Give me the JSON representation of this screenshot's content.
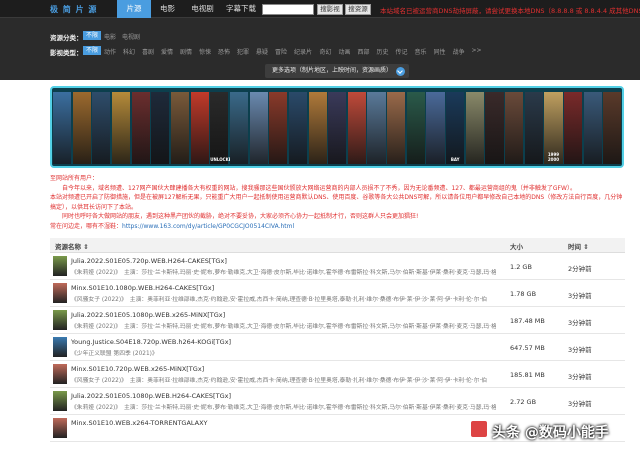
{
  "header": {
    "logo": "极 简 片 源",
    "tabs": [
      {
        "label": "片源",
        "active": true
      },
      {
        "label": "电影",
        "active": false
      },
      {
        "label": "电视剧",
        "active": false
      },
      {
        "label": "字幕下载",
        "active": false
      }
    ],
    "search_value": "",
    "search_btn": "搜影视",
    "search_btn2": "搜资源",
    "notice": "本站域名已被运营商DNS劫持屏蔽，请尝试更换本地DNS（8.8.8.8 或 8.8.4.4 成其他DNS）"
  },
  "filters": {
    "row1_label": "资源分类：",
    "row1_selected": "不限",
    "row1_options": [
      "电影",
      "电视剧"
    ],
    "row2_label": "影视类型：",
    "row2_selected": "不限",
    "row2_options": [
      "动作",
      "科幻",
      "喜剧",
      "爱情",
      "剧情",
      "惊悚",
      "恐怖",
      "犯罪",
      "悬疑",
      "冒险",
      "纪录片",
      "奇幻",
      "动画",
      "西部",
      "历史",
      "传记",
      "音乐",
      "同性",
      "战争",
      ">>"
    ],
    "more_label": "更多选项（制片地区，上映时间，资源画质）"
  },
  "banner": {
    "posters": [
      {
        "title": "",
        "color": "#3b6fa0"
      },
      {
        "title": "",
        "color": "#9c6a2e"
      },
      {
        "title": "",
        "color": "#2e4d6b"
      },
      {
        "title": "",
        "color": "#b58b3a"
      },
      {
        "title": "",
        "color": "#6b2e2e"
      },
      {
        "title": "",
        "color": "#1e2a3a"
      },
      {
        "title": "",
        "color": "#7a5a3a"
      },
      {
        "title": "",
        "color": "#c23a2a"
      },
      {
        "title": "UNLOCKED",
        "color": "#2a2a2a"
      },
      {
        "title": "",
        "color": "#3a6a8a"
      },
      {
        "title": "",
        "color": "#6a8ab0"
      },
      {
        "title": "",
        "color": "#8a3a2a"
      },
      {
        "title": "",
        "color": "#2a4a6a"
      },
      {
        "title": "",
        "color": "#b07a3a"
      },
      {
        "title": "",
        "color": "#3a3a5a"
      },
      {
        "title": "",
        "color": "#c04a3a"
      },
      {
        "title": "",
        "color": "#5a7a9a"
      },
      {
        "title": "",
        "color": "#9a6a4a"
      },
      {
        "title": "",
        "color": "#2a5a4a"
      },
      {
        "title": "",
        "color": "#4a6a9a"
      },
      {
        "title": "BAY",
        "color": "#1a3a5a"
      },
      {
        "title": "",
        "color": "#8a8a6a"
      },
      {
        "title": "",
        "color": "#3a2a2a"
      },
      {
        "title": "",
        "color": "#6a4a3a"
      },
      {
        "title": "",
        "color": "#2a3a4a"
      },
      {
        "title": "1999 2000",
        "color": "#c0a060"
      },
      {
        "title": "",
        "color": "#7a2a2a"
      },
      {
        "title": "",
        "color": "#3a5a7a"
      },
      {
        "title": "",
        "color": "#5a3a2a"
      }
    ]
  },
  "info": {
    "lines": [
      "至网站所有用户：",
      "　　自今年以来，域名频遭、127网产国伙大肆建播各大有权重的网站，搜我骚那这些国伙颁放大网络运营商的内部人员损不了不秀，因为无论番频遭、127、都最运营商组的鬼（并非触发了GFW）。",
      "本站对频遭已开启了防御措施，但是在被屏127解析无果，只能重广大用户一起抵制使用运营商默认DNS、使用百度、谷歌等各大公共DNS可解，所以请各位用户都早修改自己本地的DNS（修改方法自行百度，几分钟搞定），以供耳长访问下了本站。",
      "　　同时也呼吁各大做网站的朋友，遇到这种黑产团伙的截胁，绝对不要妥协，大家必须齐心协力一起抵制才行，否则这群人只会更加猖狂!"
    ],
    "feedback_label": "常在问边走，哪有不湿鞋：",
    "feedback_link": "https://www.163.com/dy/article/GP0CGCJO0514CIVA.html"
  },
  "table": {
    "col_name": "资源名称 ⇕",
    "col_size": "大小",
    "col_time": "时间 ⇕",
    "rows": [
      {
        "title": "Julia.2022.S01E05.720p.WEB.H264-CAKES[TGx]",
        "cast": "《朱莉娅 (2022)》　主演：莎拉·兰卡斯特,玛丽·史·妮布,萝布·勒维克,大卫·海德·皮尔斯,毕比·诺维尔,霍华德·布雷斯拉·科文斯,马尔·伯斯·斯基·伊莱·桑利·麦克·马瑟,玛·格雷·曲·玛丽·伯·丘曼",
        "size": "1.2 GB",
        "time": "2分钟前",
        "color": "#7a9a4a"
      },
      {
        "title": "Minx.S01E10.1080p.WEB.H264-CAKES[TGx]",
        "cast": "《风骚女子 (2022)》　主演：奥菲利亚·拉维邵维,杰克·约翰逊,安·霍拉威,杰西卡·简纳,理查德·B·拉里奥塔,泰勒·扎利·维尔·桑德·布伊·莱·伊·沙·莱·阿·伊·卡利·伦·尔·伯",
        "size": "1.78 GB",
        "time": "3分钟前",
        "color": "#c06a5a"
      },
      {
        "title": "Julia.2022.S01E05.1080p.WEB.x265-MiNX[TGx]",
        "cast": "《朱莉娅 (2022)》　主演：莎拉·兰卡斯特,玛丽·史·妮布,萝布·勒维克,大卫·海德·皮尔斯,毕比·诺维尔,霍华德·布雷斯拉·科文斯,马尔·伯斯·斯基·伊莱·桑利·麦克·马瑟,玛·格雷·曲·玛丽·伯·丘曼",
        "size": "187.48 MB",
        "time": "3分钟前",
        "color": "#7a9a4a"
      },
      {
        "title": "Young.Justice.S04E18.720p.WEB.h264-KOGi[TGx]",
        "cast": "《少年正义联盟 第四季 (2021)》",
        "size": "647.57 MB",
        "time": "3分钟前",
        "color": "#3a7ab0"
      },
      {
        "title": "Minx.S01E10.720p.WEB.x265-MiNX[TGx]",
        "cast": "《风骚女子 (2022)》　主演：奥菲利亚·拉维邵维,杰克·约翰逊,安·霍拉威,杰西卡·简纳,理查德·B·拉里奥塔,泰勒·扎利·维尔·桑德·布伊·莱·伊·沙·莱·阿·伊·卡利·伦·尔·伯",
        "size": "185.81 MB",
        "time": "3分钟前",
        "color": "#c06a5a"
      },
      {
        "title": "Julia.2022.S01E05.1080p.WEB.H264-CAKES[TGx]",
        "cast": "《朱莉娅 (2022)》　主演：莎拉·兰卡斯特,玛丽·史·妮布,萝布·勒维克,大卫·海德·皮尔斯,毕比·诺维尔,霍华德·布雷斯拉·科文斯,马尔·伯斯·斯基·伊莱·桑利·麦克·马瑟,玛·格雷·曲·玛丽·伯·丘曼",
        "size": "2.72 GB",
        "time": "3分钟前",
        "color": "#7a9a4a"
      },
      {
        "title": "Minx.S01E10.WEB.x264-TORRENTGALAXY",
        "cast": "",
        "size": "",
        "time": "",
        "color": "#c06a5a"
      }
    ]
  },
  "watermark": {
    "text": "头条 @数码小能手"
  }
}
